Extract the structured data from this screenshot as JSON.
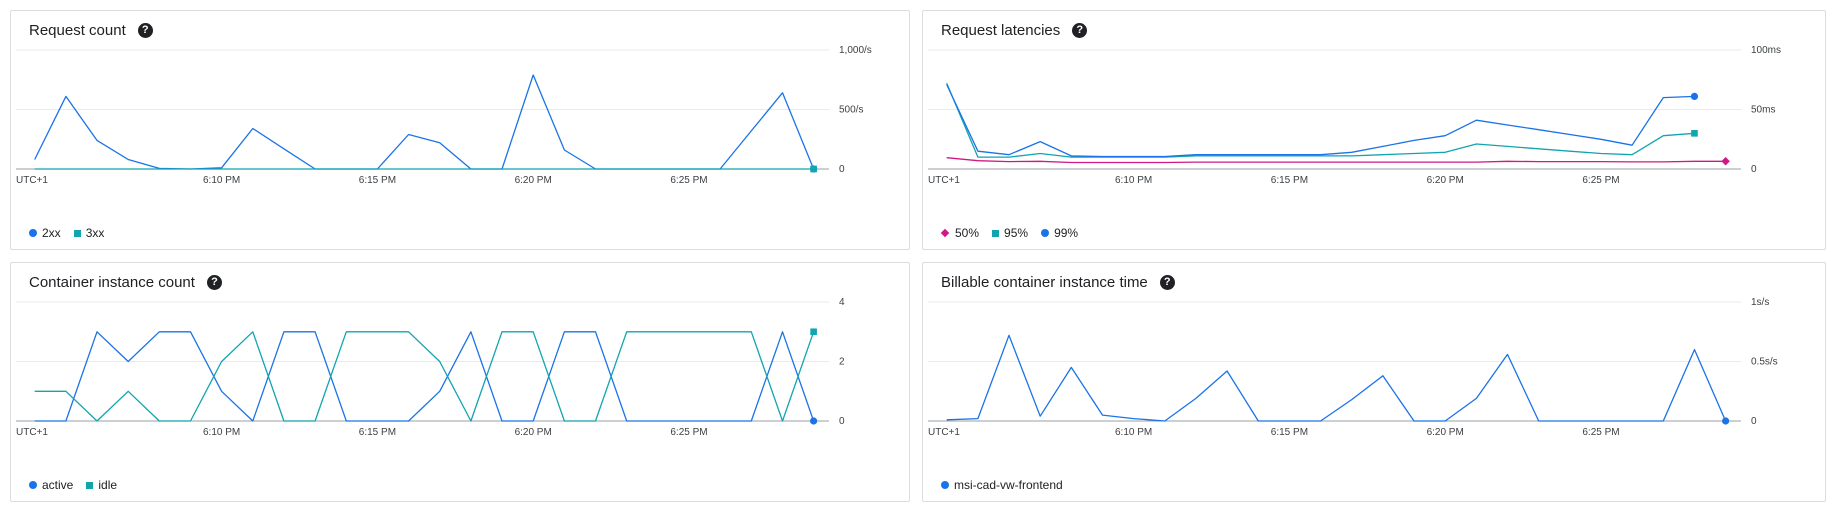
{
  "panels": [
    {
      "title": "Request count",
      "xticks": [
        "UTC+1",
        "6:10 PM",
        "6:15 PM",
        "6:20 PM",
        "6:25 PM"
      ],
      "yticks": [
        "0",
        "500/s",
        "1,000/s"
      ],
      "series": [
        {
          "name": "2xx",
          "marker": "circle",
          "color": "#1a73e8"
        },
        {
          "name": "3xx",
          "marker": "square",
          "color": "#12a4af"
        }
      ]
    },
    {
      "title": "Request latencies",
      "xticks": [
        "UTC+1",
        "6:10 PM",
        "6:15 PM",
        "6:20 PM",
        "6:25 PM"
      ],
      "yticks": [
        "0",
        "50ms",
        "100ms"
      ],
      "series": [
        {
          "name": "50%",
          "marker": "diamond",
          "color": "#d01884"
        },
        {
          "name": "95%",
          "marker": "square",
          "color": "#12a4af"
        },
        {
          "name": "99%",
          "marker": "circle",
          "color": "#1a73e8"
        }
      ]
    },
    {
      "title": "Container instance count",
      "xticks": [
        "UTC+1",
        "6:10 PM",
        "6:15 PM",
        "6:20 PM",
        "6:25 PM"
      ],
      "yticks": [
        "0",
        "2",
        "4"
      ],
      "series": [
        {
          "name": "active",
          "marker": "circle",
          "color": "#1a73e8"
        },
        {
          "name": "idle",
          "marker": "square",
          "color": "#12a4af"
        }
      ]
    },
    {
      "title": "Billable container instance time",
      "xticks": [
        "UTC+1",
        "6:10 PM",
        "6:15 PM",
        "6:20 PM",
        "6:25 PM"
      ],
      "yticks": [
        "0",
        "0.5s/s",
        "1s/s"
      ],
      "series": [
        {
          "name": "msi-cad-vw-frontend",
          "marker": "circle",
          "color": "#1a73e8"
        }
      ]
    }
  ],
  "chart_data": [
    {
      "type": "line",
      "title": "Request count",
      "x_minutes_after_6pm": [
        4,
        5,
        6,
        7,
        8,
        9,
        10,
        11,
        12,
        13,
        14,
        15,
        16,
        17,
        18,
        19,
        20,
        21,
        22,
        23,
        24,
        25,
        26,
        27,
        28,
        29
      ],
      "x_tick_labels": [
        "UTC+1",
        "6:10 PM",
        "6:15 PM",
        "6:20 PM",
        "6:25 PM"
      ],
      "ylim": [
        0,
        1000
      ],
      "y_unit": "/s",
      "series": [
        {
          "name": "2xx",
          "color": "#1a73e8",
          "values": [
            80,
            610,
            240,
            80,
            5,
            0,
            10,
            340,
            170,
            0,
            0,
            0,
            290,
            220,
            0,
            0,
            790,
            160,
            0,
            0,
            0,
            0,
            0,
            320,
            640,
            0
          ]
        },
        {
          "name": "3xx",
          "color": "#12a4af",
          "values": [
            0,
            0,
            0,
            0,
            0,
            0,
            0,
            0,
            0,
            0,
            0,
            0,
            0,
            0,
            0,
            0,
            0,
            0,
            0,
            0,
            0,
            0,
            0,
            0,
            0,
            0
          ]
        }
      ]
    },
    {
      "type": "line",
      "title": "Request latencies",
      "x_minutes_after_6pm": [
        4,
        5,
        6,
        7,
        8,
        9,
        10,
        11,
        12,
        13,
        14,
        15,
        16,
        17,
        18,
        19,
        20,
        21,
        22,
        23,
        24,
        25,
        26,
        27,
        28,
        29
      ],
      "x_tick_labels": [
        "UTC+1",
        "6:10 PM",
        "6:15 PM",
        "6:20 PM",
        "6:25 PM"
      ],
      "ylim": [
        0,
        100
      ],
      "y_unit": "ms",
      "series": [
        {
          "name": "50%",
          "color": "#d01884",
          "values": [
            9.5,
            7,
            6.2,
            6.5,
            5.5,
            5.5,
            5.5,
            5.5,
            5.8,
            5.8,
            5.8,
            5.8,
            5.8,
            5.8,
            5.8,
            5.8,
            5.8,
            5.8,
            6.5,
            6.2,
            6.2,
            6.2,
            6,
            6,
            6.5,
            6.5
          ]
        },
        {
          "name": "95%",
          "color": "#12a4af",
          "values": [
            72,
            10,
            10,
            13,
            10,
            10,
            10,
            10,
            11,
            11,
            11,
            11,
            11,
            11,
            12,
            13,
            14,
            21,
            19,
            17,
            15,
            13,
            12,
            28,
            30
          ]
        },
        {
          "name": "99%",
          "color": "#1a73e8",
          "values": [
            71,
            15,
            12,
            23,
            11,
            10.5,
            10.5,
            10.5,
            12,
            12,
            12,
            12,
            12,
            14,
            19,
            24,
            28,
            41,
            37,
            33,
            29,
            25,
            20,
            60,
            61
          ]
        }
      ]
    },
    {
      "type": "line",
      "title": "Container instance count",
      "x_minutes_after_6pm": [
        4,
        5,
        6,
        7,
        8,
        9,
        10,
        11,
        12,
        13,
        14,
        15,
        16,
        17,
        18,
        19,
        20,
        21,
        22,
        23,
        24,
        25,
        26,
        27,
        28,
        29
      ],
      "x_tick_labels": [
        "UTC+1",
        "6:10 PM",
        "6:15 PM",
        "6:20 PM",
        "6:25 PM"
      ],
      "ylim": [
        0,
        4
      ],
      "series": [
        {
          "name": "active",
          "color": "#1a73e8",
          "values": [
            0,
            0,
            3,
            2,
            3,
            3,
            1,
            0,
            3,
            3,
            0,
            0,
            0,
            1,
            3,
            0,
            0,
            3,
            3,
            0,
            0,
            0,
            0,
            0,
            3,
            0
          ]
        },
        {
          "name": "idle",
          "color": "#12a4af",
          "values": [
            1,
            1,
            0,
            1,
            0,
            0,
            2,
            3,
            0,
            0,
            3,
            3,
            3,
            2,
            0,
            3,
            3,
            0,
            0,
            3,
            3,
            3,
            3,
            3,
            0,
            3
          ]
        }
      ]
    },
    {
      "type": "line",
      "title": "Billable container instance time",
      "x_minutes_after_6pm": [
        4,
        5,
        6,
        7,
        8,
        9,
        10,
        11,
        12,
        13,
        14,
        15,
        16,
        17,
        18,
        19,
        20,
        21,
        22,
        23,
        24,
        25,
        26,
        27,
        28,
        29
      ],
      "x_tick_labels": [
        "UTC+1",
        "6:10 PM",
        "6:15 PM",
        "6:20 PM",
        "6:25 PM"
      ],
      "ylim": [
        0,
        1
      ],
      "y_unit": "s/s",
      "series": [
        {
          "name": "msi-cad-vw-frontend",
          "color": "#1a73e8",
          "values": [
            0.01,
            0.02,
            0.72,
            0.04,
            0.45,
            0.05,
            0.02,
            0,
            0.19,
            0.42,
            0,
            0,
            0,
            0.18,
            0.38,
            0,
            0,
            0.19,
            0.56,
            0,
            0,
            0,
            0,
            0,
            0.6,
            0
          ]
        }
      ]
    }
  ]
}
